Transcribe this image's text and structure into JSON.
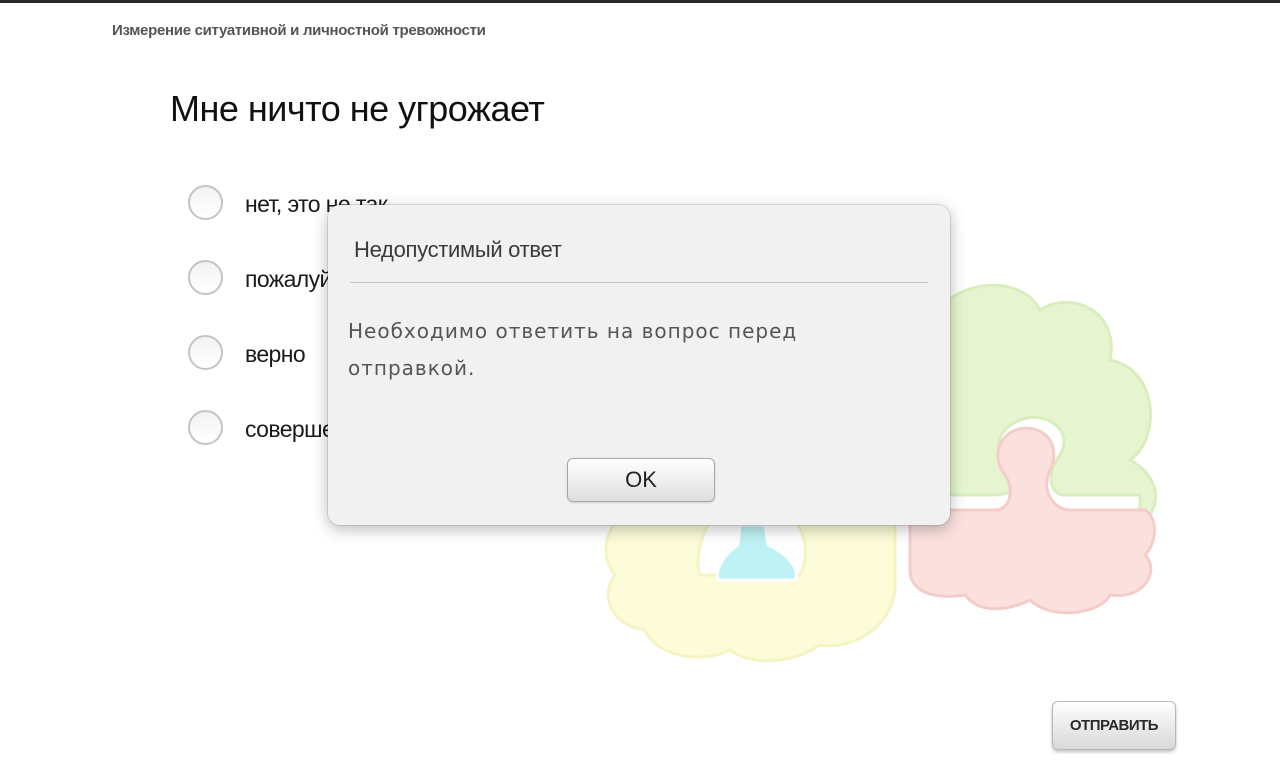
{
  "header": {
    "app_title": "Измерение ситуативной и личностной тревожности"
  },
  "question": {
    "text": "Мне ничто не угрожает",
    "options": [
      {
        "label": "нет, это не так"
      },
      {
        "label": "пожалуй, так"
      },
      {
        "label": "верно"
      },
      {
        "label": "совершенно верно"
      }
    ]
  },
  "dialog": {
    "title": "Недопустимый ответ",
    "message": "Необходимо ответить на вопрос перед отправкой.",
    "ok_label": "OK"
  },
  "footer": {
    "submit_label": "ОТПРАВИТЬ"
  },
  "icons": {
    "puzzle": "puzzle-logo-icon",
    "radio": "radio-button-icon"
  },
  "colors": {
    "puzzle_green": "#e6f5d0",
    "puzzle_red": "#fbe0de",
    "puzzle_yellow": "#fcfcd8",
    "puzzle_blue": "#bff2f4"
  }
}
